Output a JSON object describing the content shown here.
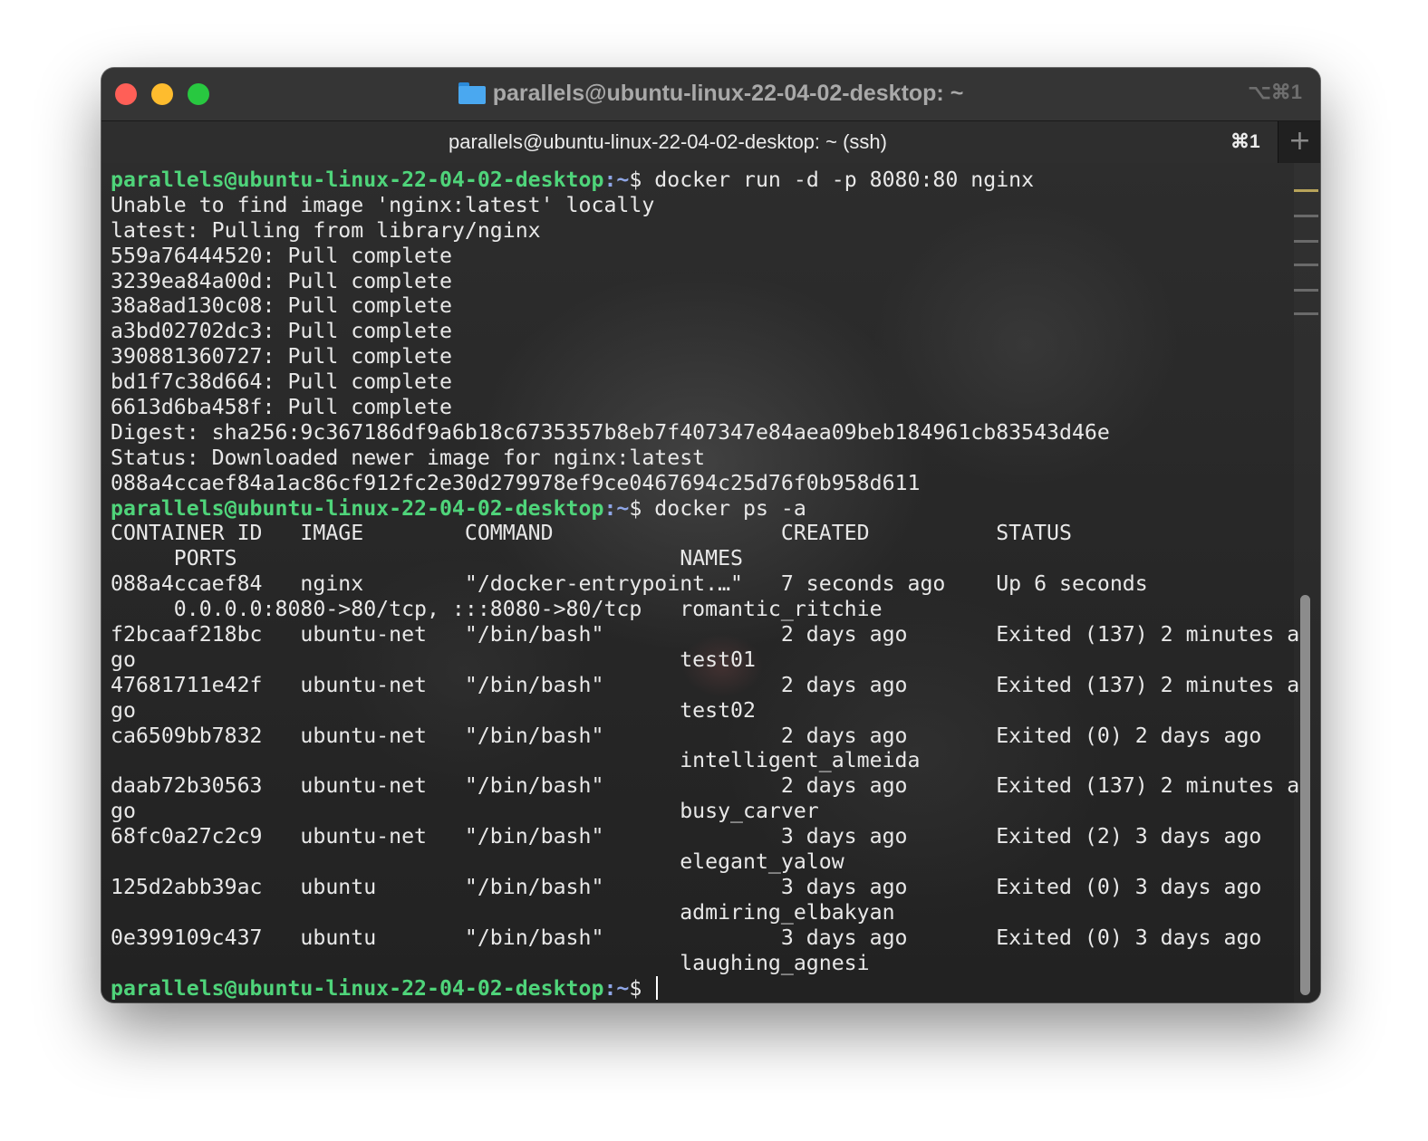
{
  "window": {
    "title": "parallels@ubuntu-linux-22-04-02-desktop: ~",
    "title_shortcut": "⌥⌘1",
    "folder_icon": "folder-icon"
  },
  "tabs": [
    {
      "label": "parallels@ubuntu-linux-22-04-02-desktop: ~ (ssh)",
      "shortcut": "⌘1"
    }
  ],
  "new_tab_icon": "plus-icon",
  "terminal": {
    "prompt_user": "parallels@ubuntu-linux-22-04-02-desktop",
    "prompt_path": ":~",
    "prompt_symbol": "$ ",
    "lines": [
      {
        "type": "prompt",
        "text": "docker run -d -p 8080:80 nginx"
      },
      {
        "type": "output",
        "text": "Unable to find image 'nginx:latest' locally"
      },
      {
        "type": "output",
        "text": "latest: Pulling from library/nginx"
      },
      {
        "type": "output",
        "text": "559a76444520: Pull complete"
      },
      {
        "type": "output",
        "text": "3239ea84a00d: Pull complete"
      },
      {
        "type": "output",
        "text": "38a8ad130c08: Pull complete"
      },
      {
        "type": "output",
        "text": "a3bd02702dc3: Pull complete"
      },
      {
        "type": "output",
        "text": "390881360727: Pull complete"
      },
      {
        "type": "output",
        "text": "bd1f7c38d664: Pull complete"
      },
      {
        "type": "output",
        "text": "6613d6ba458f: Pull complete"
      },
      {
        "type": "output",
        "text": "Digest: sha256:9c367186df9a6b18c6735357b8eb7f407347e84aea09beb184961cb83543d46e"
      },
      {
        "type": "output",
        "text": "Status: Downloaded newer image for nginx:latest"
      },
      {
        "type": "output",
        "text": "088a4ccaef84a1ac86cf912fc2e30d279978ef9ce0467694c25d76f0b958d611"
      },
      {
        "type": "prompt",
        "text": "docker ps -a"
      },
      {
        "type": "output",
        "text": "CONTAINER ID   IMAGE        COMMAND                  CREATED          STATUS"
      },
      {
        "type": "output",
        "text": "     PORTS                                   NAMES"
      },
      {
        "type": "output",
        "text": "088a4ccaef84   nginx        \"/docker-entrypoint.…\"   7 seconds ago    Up 6 seconds"
      },
      {
        "type": "output",
        "text": "     0.0.0.0:8080->80/tcp, :::8080->80/tcp   romantic_ritchie"
      },
      {
        "type": "output",
        "text": "f2bcaaf218bc   ubuntu-net   \"/bin/bash\"              2 days ago       Exited (137) 2 minutes a"
      },
      {
        "type": "output",
        "text": "go                                           test01"
      },
      {
        "type": "output",
        "text": "47681711e42f   ubuntu-net   \"/bin/bash\"              2 days ago       Exited (137) 2 minutes a"
      },
      {
        "type": "output",
        "text": "go                                           test02"
      },
      {
        "type": "output",
        "text": "ca6509bb7832   ubuntu-net   \"/bin/bash\"              2 days ago       Exited (0) 2 days ago"
      },
      {
        "type": "output",
        "text": "                                             intelligent_almeida"
      },
      {
        "type": "output",
        "text": "daab72b30563   ubuntu-net   \"/bin/bash\"              2 days ago       Exited (137) 2 minutes a"
      },
      {
        "type": "output",
        "text": "go                                           busy_carver"
      },
      {
        "type": "output",
        "text": "68fc0a27c2c9   ubuntu-net   \"/bin/bash\"              3 days ago       Exited (2) 3 days ago"
      },
      {
        "type": "output",
        "text": "                                             elegant_yalow"
      },
      {
        "type": "output",
        "text": "125d2abb39ac   ubuntu       \"/bin/bash\"              3 days ago       Exited (0) 3 days ago"
      },
      {
        "type": "output",
        "text": "                                             admiring_elbakyan"
      },
      {
        "type": "output",
        "text": "0e399109c437   ubuntu       \"/bin/bash\"              3 days ago       Exited (0) 3 days ago"
      },
      {
        "type": "output",
        "text": "                                             laughing_agnesi"
      },
      {
        "type": "prompt",
        "text": "",
        "cursor": true
      }
    ]
  },
  "colors": {
    "prompt_user": "#4fd47a",
    "prompt_path": "#8fa6e6",
    "text": "#e8e8e8",
    "close": "#ff5f57",
    "minimize": "#febc2e",
    "maximize": "#28c840"
  }
}
